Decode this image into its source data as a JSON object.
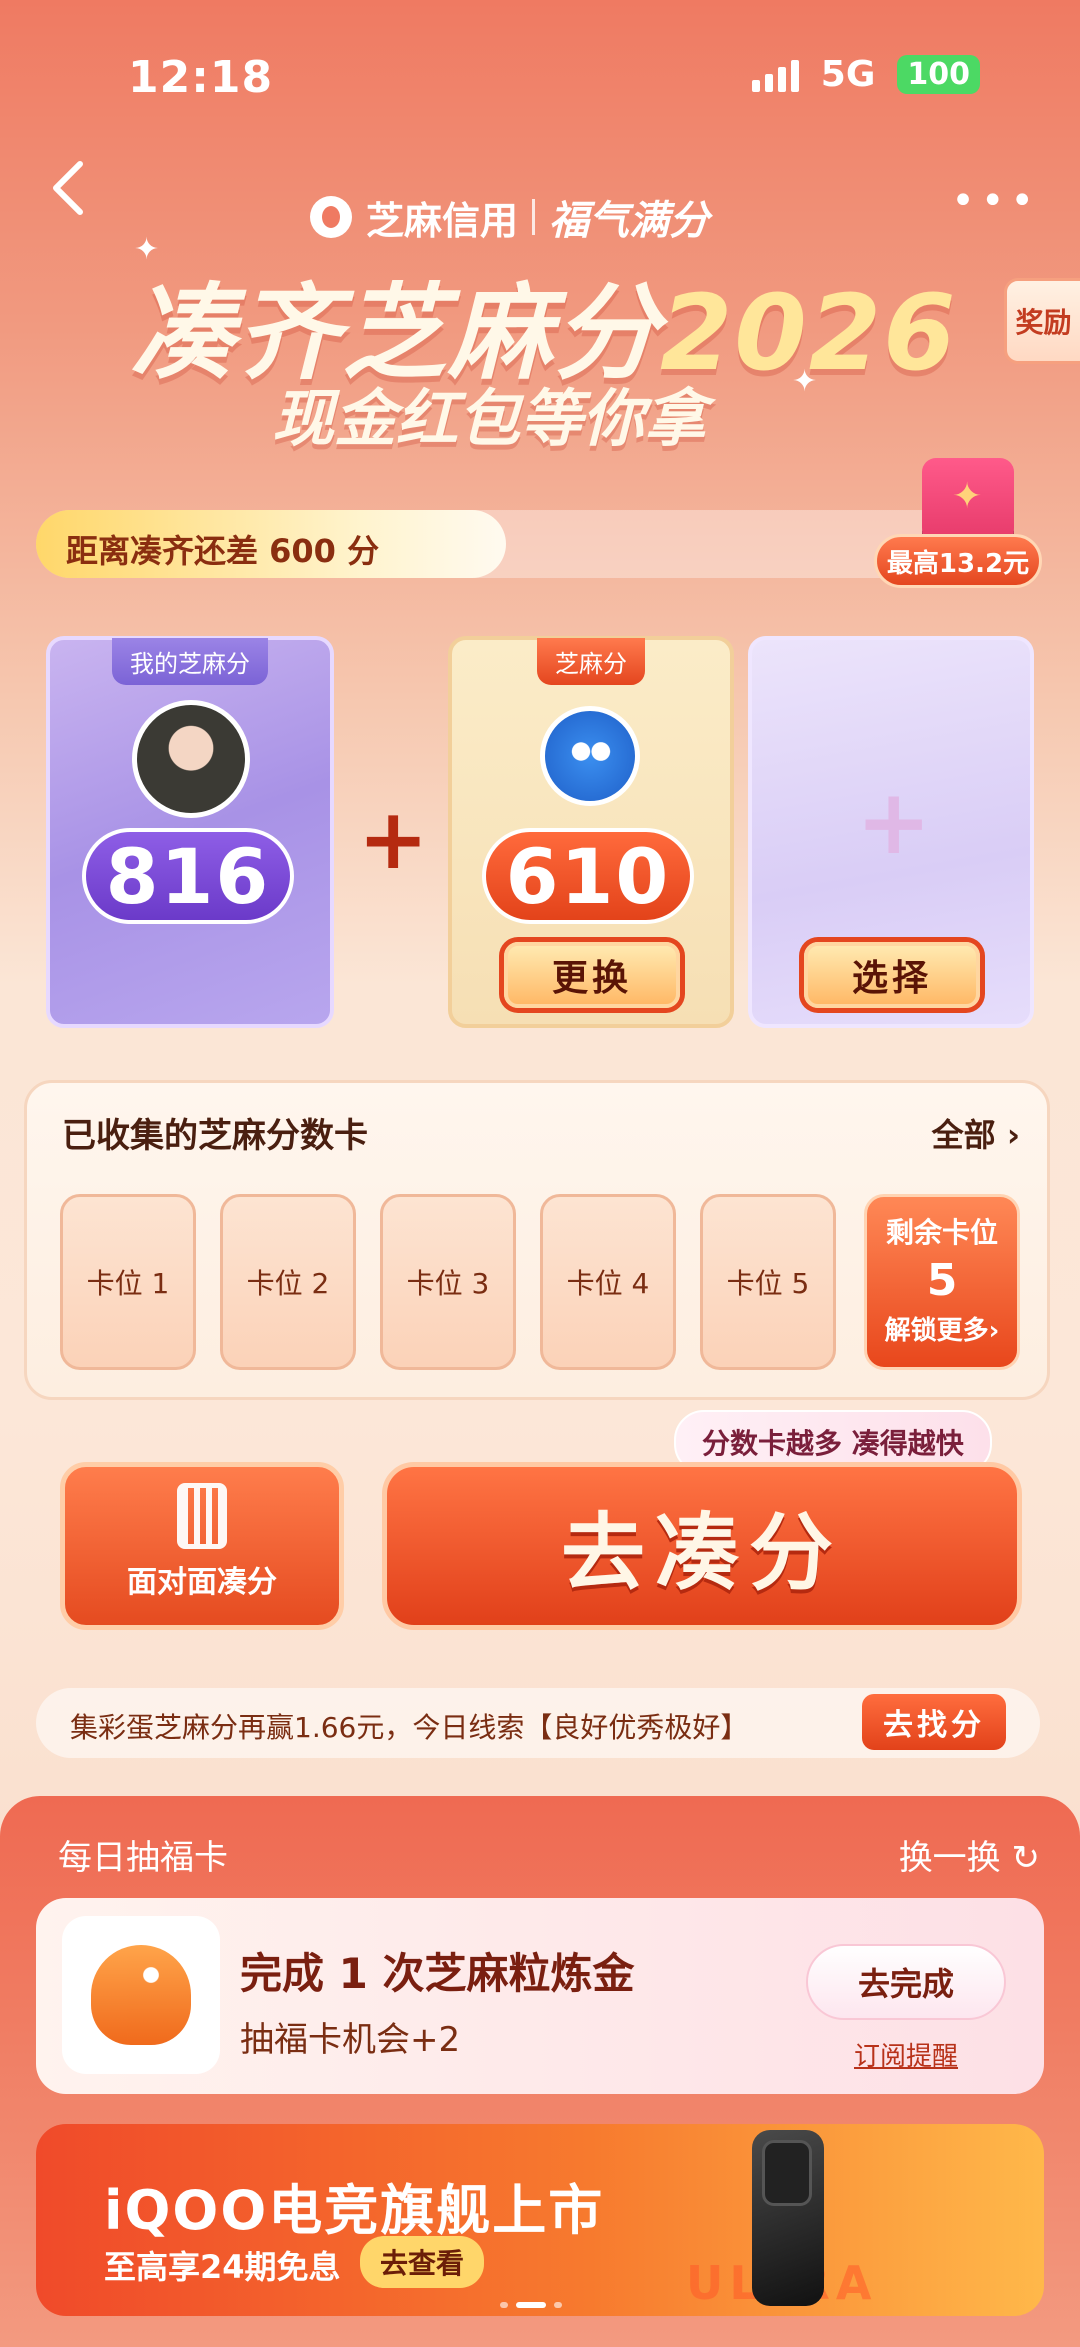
{
  "status_bar": {
    "time": "12:18",
    "network": "5G",
    "battery": "100"
  },
  "header": {
    "brand_name": "芝麻信用",
    "brand_slogan": "福气满分",
    "headline": "凑齐芝麻分",
    "headline_year": "2026",
    "subhead": "现金红包等你拿",
    "reward_tab": "奖励"
  },
  "progress": {
    "text": "距离凑齐还差 600 分",
    "fill_fraction": 0.5,
    "max_badge": "最高13.2元"
  },
  "cards": {
    "mine": {
      "label": "我的芝麻分",
      "score": "816"
    },
    "friend": {
      "label": "芝麻分",
      "score": "610",
      "button": "更换"
    },
    "select": {
      "button": "选择"
    }
  },
  "collected": {
    "title": "已收集的芝麻分数卡",
    "all_link": "全部",
    "slots": [
      "卡位 1",
      "卡位 2",
      "卡位 3",
      "卡位 4",
      "卡位 5"
    ],
    "remaining": {
      "label": "剩余卡位",
      "count": "5",
      "unlock": "解锁更多"
    }
  },
  "actions": {
    "tip": "分数卡越多 凑得越快",
    "face_to_face": "面对面凑分",
    "go": "去凑分"
  },
  "clue": {
    "text": "集彩蛋芝麻分再赢1.66元，今日线索【良好优秀极好】",
    "button": "去找分"
  },
  "daily": {
    "title": "每日抽福卡",
    "refresh": "换一换",
    "task_title": "完成 1 次芝麻粒炼金",
    "task_sub": "抽福卡机会+2",
    "task_button": "去完成",
    "subscribe": "订阅提醒"
  },
  "ad": {
    "title": "iQOO电竞旗舰上市",
    "sub": "至高享24期免息",
    "button": "去查看",
    "watermark": "ULTRA"
  }
}
